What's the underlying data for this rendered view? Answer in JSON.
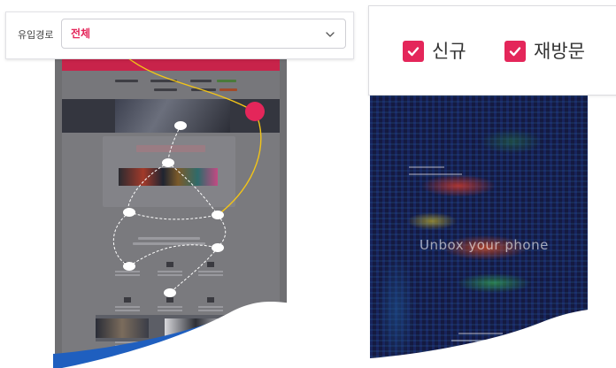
{
  "filter": {
    "label": "유입경로",
    "selected_value": "전체",
    "chevron_icon": "chevron-down-icon",
    "accent_color": "#e4265a"
  },
  "legend": {
    "items": [
      {
        "label": "신규",
        "checked": true,
        "icon": "check-icon"
      },
      {
        "label": "재방문",
        "checked": true,
        "icon": "check-icon"
      }
    ],
    "checkbox_color": "#e4265a"
  },
  "left_preview": {
    "hero_title": "Discover Flexible",
    "flow_color": "#f2c418",
    "path_color": "#ffffff",
    "entry_marker_color": "#e4265a"
  },
  "right_preview": {
    "heatmap_text": "Unbox your phone"
  }
}
